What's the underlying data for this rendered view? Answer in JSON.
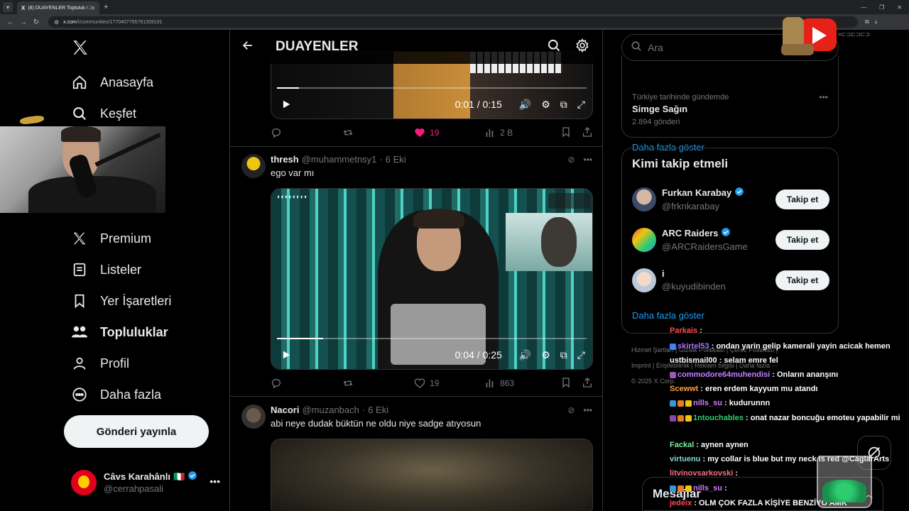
{
  "browser": {
    "tab_title": "(8) DUAYENLER Topluluk / X",
    "url_host": "x.com",
    "url_path": "/i/communities/1770407765791359191"
  },
  "sidebar": {
    "items": [
      {
        "label": "Anasayfa",
        "icon": "home-icon"
      },
      {
        "label": "Keşfet",
        "icon": "search-icon"
      },
      {
        "label": "Premium",
        "icon": "x-logo-icon"
      },
      {
        "label": "Listeler",
        "icon": "list-icon"
      },
      {
        "label": "Yer İşaretleri",
        "icon": "bookmark-icon"
      },
      {
        "label": "Topluluklar",
        "icon": "communities-icon"
      },
      {
        "label": "Profil",
        "icon": "profile-icon"
      },
      {
        "label": "Daha fazla",
        "icon": "more-circle-icon"
      }
    ],
    "post_button": "Gönderi yayınla",
    "user": {
      "name": "Câvs Karahânlı",
      "flag": "🇮🇹",
      "handle": "@cerrahpasali"
    }
  },
  "header": {
    "title": "DUAYENLER"
  },
  "feed": {
    "top_video": {
      "time": "0:01 / 0:15",
      "progress": 0.07
    },
    "top_actions": {
      "likes": "19",
      "views": "2 B"
    },
    "tweets": [
      {
        "name": "thresh",
        "handle": "@muhammetnsy1",
        "date": "6 Eki",
        "text": "ego var mı",
        "video": {
          "time": "0:04 / 0:25",
          "progress": 0.15
        },
        "actions": {
          "likes": "19",
          "views": "863"
        }
      },
      {
        "name": "Nacori",
        "handle": "@muzanbach",
        "date": "6 Eki",
        "text": "abi neye dudak büktün ne oldu niye sadge atıyosun"
      }
    ]
  },
  "right": {
    "search_placeholder": "Ara",
    "trend": {
      "sub": "Türkiye tarihinde gündemde",
      "name": "Simge Sağın",
      "count": "2.894 gönderi",
      "show_more": "Daha fazla göster"
    },
    "who_to_follow": {
      "title": "Kimi takip etmeli",
      "follow_label": "Takip et",
      "users": [
        {
          "name": "Furkan Karabay",
          "handle": "@frknkarabay",
          "verified": true
        },
        {
          "name": "ARC Raiders",
          "handle": "@ARCRaidersGame",
          "verified": true
        },
        {
          "name": "i",
          "handle": "@kuyudibinden",
          "verified": false
        }
      ],
      "show_more": "Daha fazla göster"
    },
    "footer": {
      "line1": "Hizmet Şartları  |  Gizlilik Politikası  |  Çerez Politikası  |",
      "line2": "Imprint  |  Erişilebilirlik  |  Reklam bilgisi  |  Daha fazla ···",
      "line3": "© 2025 X Corp."
    },
    "messages_title": "Mesajlar"
  },
  "chat": [
    {
      "user": "Parkais",
      "color": "#ff4d4d",
      "msg": ":"
    },
    {
      "user": "skirtel53",
      "color": "#a970ff",
      "msg": ": ondan yarin gelip kamerali yayin acicak hemen"
    },
    {
      "user": "ustbismail00",
      "color": "#ffffff",
      "msg": ": selam emre fel"
    },
    {
      "user": "commodore64muhendisi",
      "color": "#c77dff",
      "msg": ": Onların ananşını"
    },
    {
      "user": "Scewwt",
      "color": "#ff9f43",
      "msg": ": eren erdem kayyum mu atandı"
    },
    {
      "user": "nills_su",
      "color": "#d67bff",
      "msg": ": kudurunnn"
    },
    {
      "user": "1ntouchables",
      "color": "#2ecc71",
      "msg": ": onat nazar boncuğu emoteu yapabilir mi"
    },
    {
      "user": "Fackal",
      "color": "#7bed9f",
      "msg": ": aynen aynen"
    },
    {
      "user": "virtuenu",
      "color": "#7ed6df",
      "msg": ": my collar is blue but my neck is red @CaglarArts"
    },
    {
      "user": "litvinovsarkovski",
      "color": "#ff6b81",
      "msg": ":"
    },
    {
      "user": "nills_su",
      "color": "#d67bff",
      "msg": ":"
    },
    {
      "user": "jedeix",
      "color": "#ff4757",
      "msg": ": OLM ÇOK FAZLA KİŞİYE BENZİYO AMK"
    }
  ],
  "colors": {
    "accent": "#1d9bf0",
    "like": "#f91880",
    "background": "#000000",
    "border": "#2f3336"
  }
}
